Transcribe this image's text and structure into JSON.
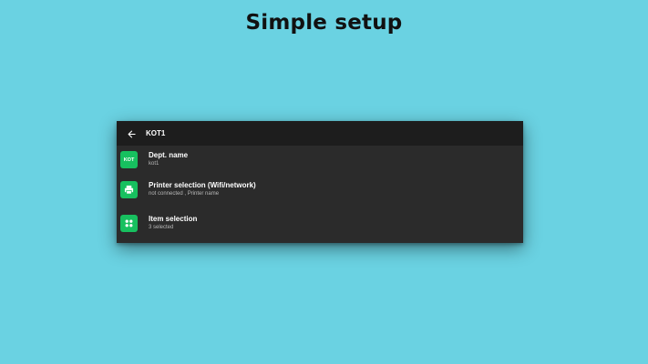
{
  "headline": "Simple setup",
  "toolbar": {
    "title": "KOT1",
    "back_icon": "arrow-left-icon"
  },
  "rows": [
    {
      "icon": "kot-badge-icon",
      "icon_text": "KOT",
      "title": "Dept. name",
      "subtitle": "kot1"
    },
    {
      "icon": "printer-icon",
      "title": "Printer selection (Wifi/network)",
      "subtitle": "not connected , Printer name"
    },
    {
      "icon": "item-grid-icon",
      "title": "Item selection",
      "subtitle": "3 selected"
    }
  ],
  "colors": {
    "background": "#6ad2e2",
    "panel": "#2b2b2b",
    "toolbar": "#1d1d1d",
    "accent": "#17c05f"
  }
}
